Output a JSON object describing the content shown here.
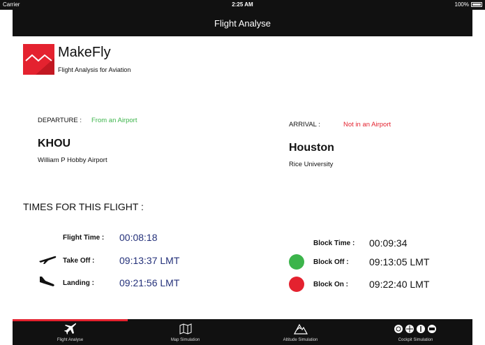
{
  "status_bar": {
    "carrier": "Carrier",
    "time": "2:25 AM",
    "battery": "100%"
  },
  "nav": {
    "title": "Flight Analyse"
  },
  "logo": {
    "name": "MakeFly",
    "tagline": "Flight Analysis for Aviation"
  },
  "departure": {
    "label": "DEPARTURE :",
    "status": "From an Airport",
    "code": "KHOU",
    "name": "William P Hobby Airport",
    "status_color": "#3cb44b"
  },
  "arrival": {
    "label": "ARRIVAL :",
    "status": "Not in an Airport",
    "code": "Houston",
    "name": "Rice University",
    "status_color": "#e4222f"
  },
  "times": {
    "title": "TIMES FOR THIS FLIGHT :",
    "flight_time": {
      "label": "Flight Time :",
      "value": "00:08:18"
    },
    "take_off": {
      "label": "Take Off :",
      "value": "09:13:37 LMT"
    },
    "landing": {
      "label": "Landing :",
      "value": "09:21:56 LMT"
    },
    "block_time": {
      "label": "Block Time :",
      "value": "00:09:34"
    },
    "block_off": {
      "label": "Block Off :",
      "value": "09:13:05 LMT",
      "dot_color": "#3cb44b"
    },
    "block_on": {
      "label": "Block On :",
      "value": "09:22:40 LMT",
      "dot_color": "#e4222f"
    }
  },
  "tabs": [
    {
      "label": "Flight Analyse",
      "icon": "airplane-icon",
      "active": true
    },
    {
      "label": "Map Simulation",
      "icon": "map-icon",
      "active": false
    },
    {
      "label": "Altitude Simulation",
      "icon": "mountain-icon",
      "active": false
    },
    {
      "label": "Cockpit Simulation",
      "icon": "gauges-icon",
      "active": false
    }
  ],
  "colors": {
    "accent": "#e4222f",
    "value_blue": "#24317a",
    "bar": "#111111"
  }
}
